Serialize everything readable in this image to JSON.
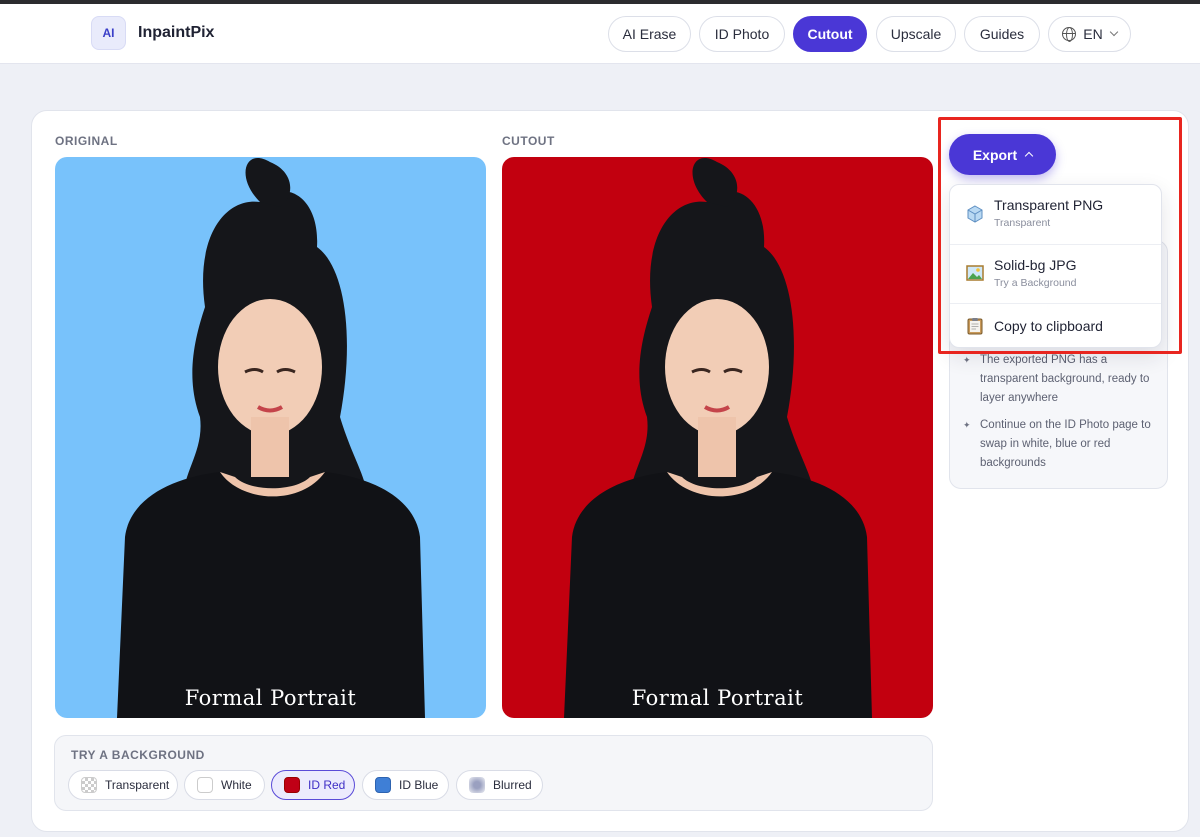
{
  "app": {
    "logo_badge": "AI",
    "name": "InpaintPix"
  },
  "nav": {
    "items": [
      {
        "label": "AI Erase",
        "active": false
      },
      {
        "label": "ID Photo",
        "active": false
      },
      {
        "label": "Cutout",
        "active": true
      },
      {
        "label": "Upscale",
        "active": false
      },
      {
        "label": "Guides",
        "active": false
      }
    ],
    "language": "EN"
  },
  "panes": {
    "original": {
      "label": "ORIGINAL",
      "caption": "Formal Portrait",
      "background": "#78c2fb"
    },
    "cutout": {
      "label": "CUTOUT",
      "caption": "Formal Portrait",
      "background": "#c2000f"
    }
  },
  "backgrounds": {
    "title": "TRY A BACKGROUND",
    "options": [
      {
        "label": "Transparent",
        "swatch": "transparent",
        "selected": false
      },
      {
        "label": "White",
        "swatch": "#ffffff",
        "selected": false
      },
      {
        "label": "ID Red",
        "swatch": "#c00016",
        "selected": true
      },
      {
        "label": "ID Blue",
        "swatch": "#3f7fd6",
        "selected": false
      },
      {
        "label": "Blurred",
        "swatch": "blurred",
        "selected": false
      }
    ]
  },
  "export": {
    "button_label": "Export",
    "menu": [
      {
        "title": "Transparent PNG",
        "subtitle": "Transparent",
        "icon": "cube-icon"
      },
      {
        "title": "Solid-bg JPG",
        "subtitle": "Try a Background",
        "icon": "image-icon"
      },
      {
        "title": "Copy to clipboard",
        "subtitle": "",
        "icon": "clipboard-icon"
      }
    ]
  },
  "tips": [
    "The exported PNG has a transparent background, ready to layer anywhere",
    "Continue on the ID Photo page to swap in white, blue or red backgrounds"
  ],
  "colors": {
    "accent": "#4a37d6",
    "highlight": "#e8251f"
  }
}
